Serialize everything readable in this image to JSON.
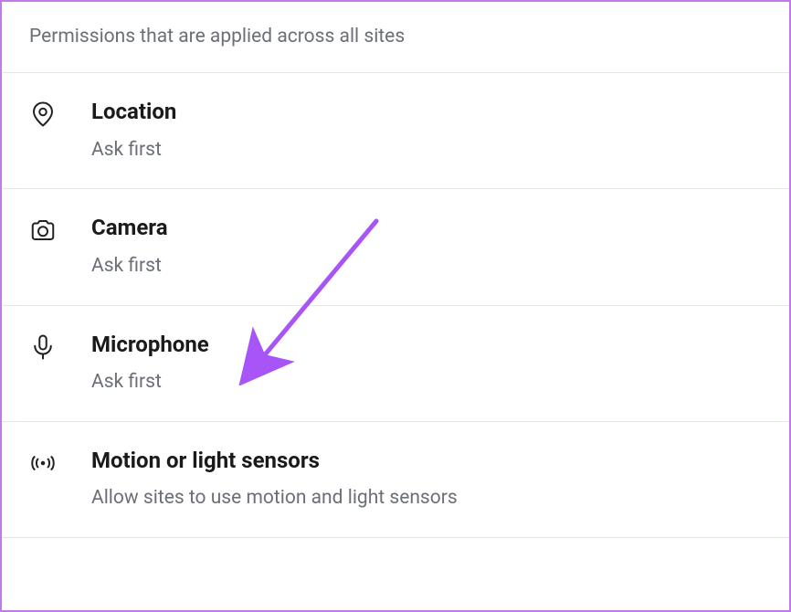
{
  "header": {
    "description": "Permissions that are applied across all sites"
  },
  "items": [
    {
      "title": "Location",
      "subtitle": "Ask first"
    },
    {
      "title": "Camera",
      "subtitle": "Ask first"
    },
    {
      "title": "Microphone",
      "subtitle": "Ask first"
    },
    {
      "title": "Motion or light sensors",
      "subtitle": "Allow sites to use motion and light sensors"
    }
  ],
  "annotation": {
    "arrow_color": "#a855f7"
  }
}
